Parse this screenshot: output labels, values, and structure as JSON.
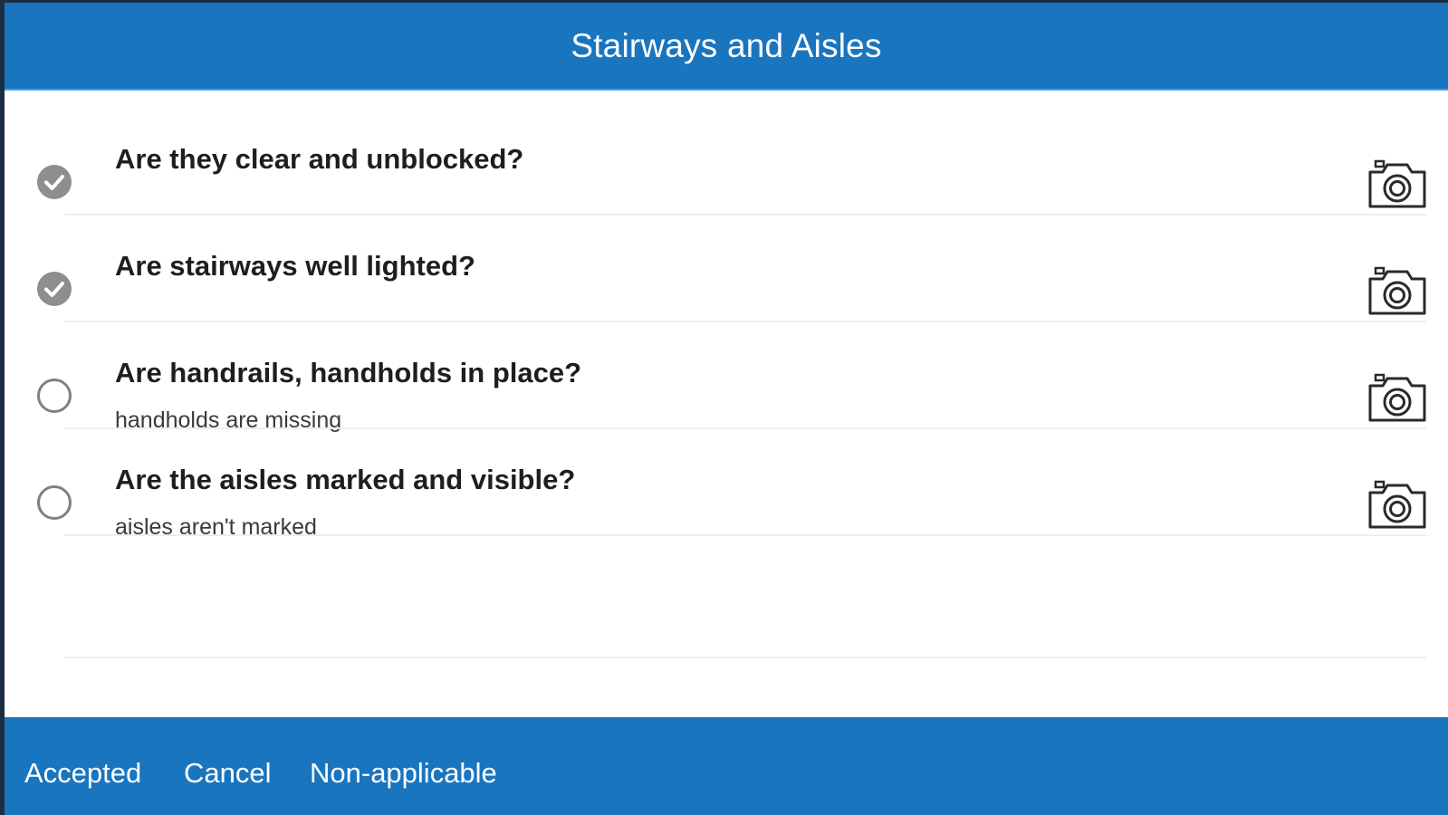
{
  "header": {
    "title": "Stairways and Aisles"
  },
  "items": [
    {
      "question": "Are they clear and unblocked?",
      "note": "",
      "checked": true,
      "icon": "camera-icon"
    },
    {
      "question": "Are stairways well lighted?",
      "note": "",
      "checked": true,
      "icon": "camera-icon"
    },
    {
      "question": "Are handrails, handholds in place?",
      "note": "handholds are missing",
      "checked": false,
      "icon": "camera-icon"
    },
    {
      "question": "Are the aisles marked and visible?",
      "note": "aisles aren't marked",
      "checked": false,
      "icon": "camera-icon"
    }
  ],
  "footer": {
    "accepted_label": "Accepted",
    "cancel_label": "Cancel",
    "non_applicable_label": "Non-applicable"
  },
  "colors": {
    "bar": "#1a75bf",
    "check_filled": "#8e8e8e",
    "check_outline": "#808080",
    "text": "#1e1e1e"
  }
}
